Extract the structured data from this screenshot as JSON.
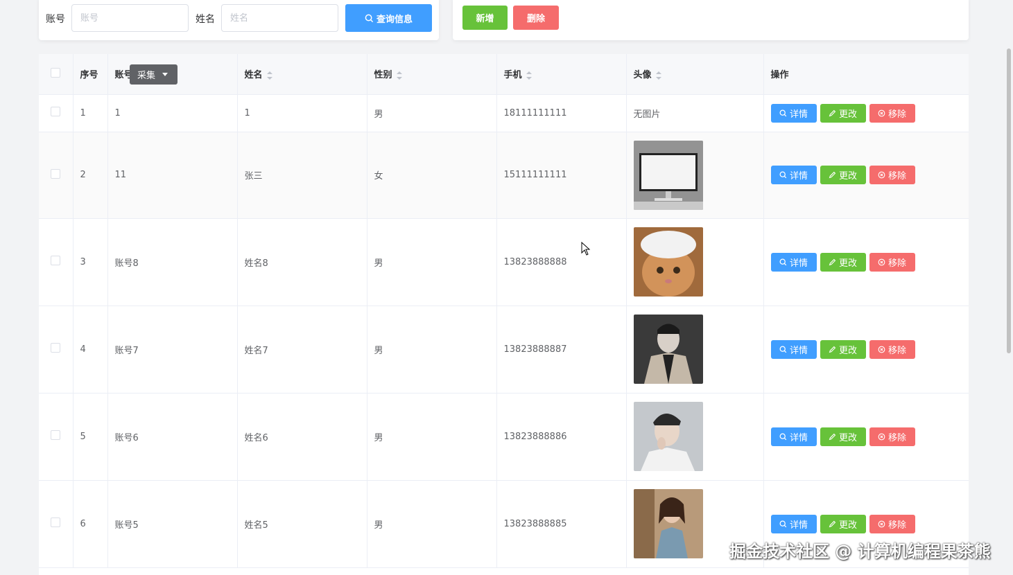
{
  "search": {
    "account_label": "账号",
    "account_placeholder": "账号",
    "name_label": "姓名",
    "name_placeholder": "姓名",
    "query_label": "查询信息"
  },
  "actions": {
    "add_label": "新增",
    "delete_label": "删除"
  },
  "table": {
    "headers": {
      "index": "序号",
      "account": "账号",
      "name": "姓名",
      "gender": "性别",
      "phone": "手机",
      "avatar": "头像",
      "ops": "操作"
    },
    "tooltip": "采集",
    "rows": [
      {
        "index": "1",
        "account": "1",
        "name": "1",
        "gender": "男",
        "phone": "18111111111",
        "avatar_text": "无图片",
        "avatar_image": "none"
      },
      {
        "index": "2",
        "account": "11",
        "name": "张三",
        "gender": "女",
        "phone": "15111111111",
        "avatar_image": "study-studio-monitor"
      },
      {
        "index": "3",
        "account": "账号8",
        "name": "姓名8",
        "gender": "男",
        "phone": "13823888888",
        "avatar_image": "cat-with-hat"
      },
      {
        "index": "4",
        "account": "账号7",
        "name": "姓名7",
        "gender": "男",
        "phone": "13823888887",
        "avatar_image": "man-in-coat"
      },
      {
        "index": "5",
        "account": "账号6",
        "name": "姓名6",
        "gender": "男",
        "phone": "13823888886",
        "avatar_image": "man-portrait"
      },
      {
        "index": "6",
        "account": "账号5",
        "name": "姓名5",
        "gender": "男",
        "phone": "13823888885",
        "avatar_image": "woman-street"
      }
    ],
    "ops": {
      "detail": "详情",
      "edit": "更改",
      "remove": "移除"
    }
  },
  "watermark": "掘金技术社区 @ 计算机编程果茶熊",
  "colors": {
    "primary": "#409eff",
    "success": "#67c23a",
    "danger": "#f56c6c"
  }
}
